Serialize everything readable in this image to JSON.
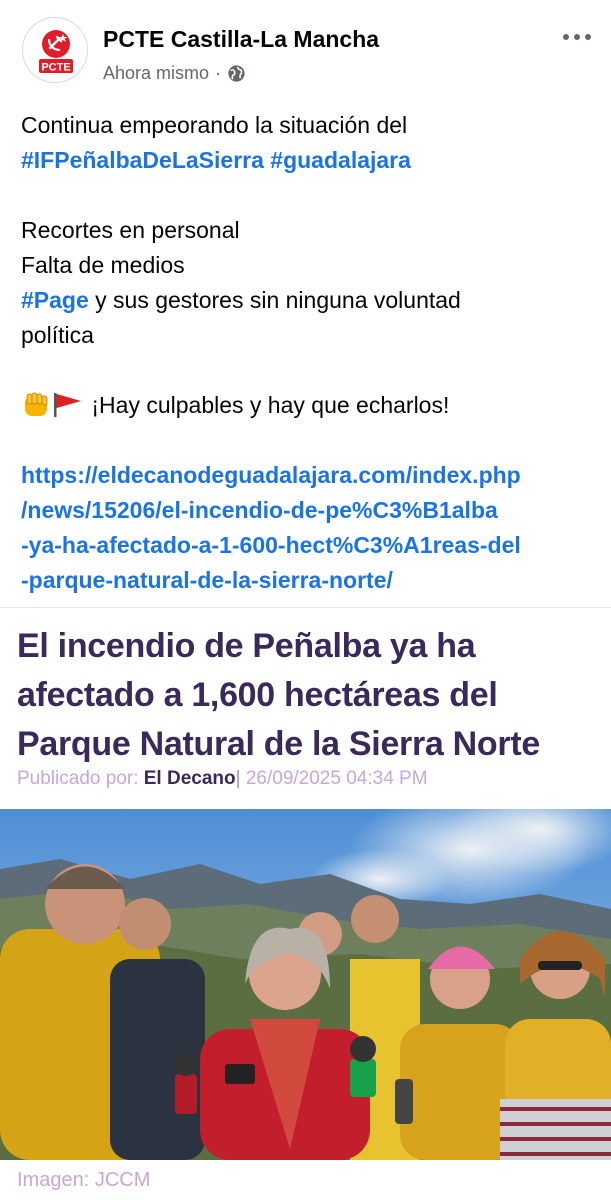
{
  "post": {
    "page_name": "PCTE Castilla-La Mancha",
    "avatar_text": "PCTE",
    "timestamp": "Ahora mismo",
    "dot": "·",
    "privacy_icon": "globe-icon",
    "menu_icon": "more-dots-icon"
  },
  "text": {
    "line1": "Continua empeorando la situación del",
    "tag1": "#IFPeñalbaDeLaSierra",
    "tag2": "#guadalajara",
    "line3": "Recortes en personal",
    "line4": "Falta de medios",
    "tag3": "#Page",
    "line5_rest": " y sus gestores sin ninguna voluntad",
    "line6": "política",
    "emoji_icons": [
      "raised-fist-icon",
      "red-flag-icon"
    ],
    "line7": "¡Hay culpables y hay que echarlos!",
    "link_lines": [
      "https://eldecanodeguadalajara.com/index.php",
      "/news/15206/el-incendio-de-pe%C3%B1alba",
      "-ya-ha-afectado-a-1-600-hect%C3%A1reas-del",
      "-parque-natural-de-la-sierra-norte/"
    ]
  },
  "preview": {
    "headline_lines": [
      "El incendio de Peñalba ya ha",
      "afectado a 1,600 hectáreas del",
      "Parque Natural de la Sierra Norte"
    ],
    "published_by_label": "Publicado por:",
    "author": "El Decano",
    "separator": "|",
    "date": "26/09/2025 04:34 PM",
    "image_credit": "Imagen: JCCM"
  },
  "colors": {
    "link": "#1b74e4",
    "headline": "#3a2a5c",
    "muted_purple": "#c9a6d6",
    "brand_red": "#e11d2a"
  }
}
